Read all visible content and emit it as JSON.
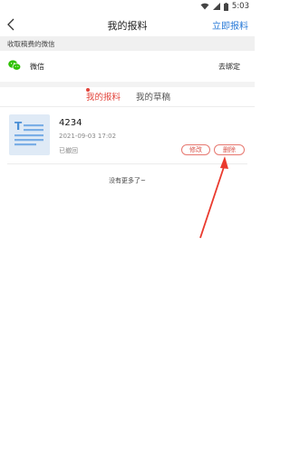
{
  "status_bar": {
    "time": "5:03"
  },
  "nav": {
    "title": "我的报料",
    "action": "立即报料"
  },
  "wechat": {
    "section_header": "收取稿费的微信",
    "label": "微信",
    "unbind": "去绑定"
  },
  "tabs": [
    {
      "label": "我的报料",
      "active": true
    },
    {
      "label": "我的草稿",
      "active": false
    }
  ],
  "items": [
    {
      "title": "4234",
      "date": "2021-09-03 17:02",
      "status": "已撤回",
      "edit_label": "修改",
      "delete_label": "删除"
    }
  ],
  "footer": {
    "no_more": "没有更多了~"
  },
  "colors": {
    "accent": "#e2433a",
    "link": "#2a7bd8",
    "wechat_green": "#2dc100",
    "annotation_arrow": "#ea3a2e"
  },
  "icons": [
    "wifi-icon",
    "signal-icon",
    "battery-icon",
    "back-arrow-icon",
    "wechat-icon",
    "document-thumbnail-icon"
  ]
}
